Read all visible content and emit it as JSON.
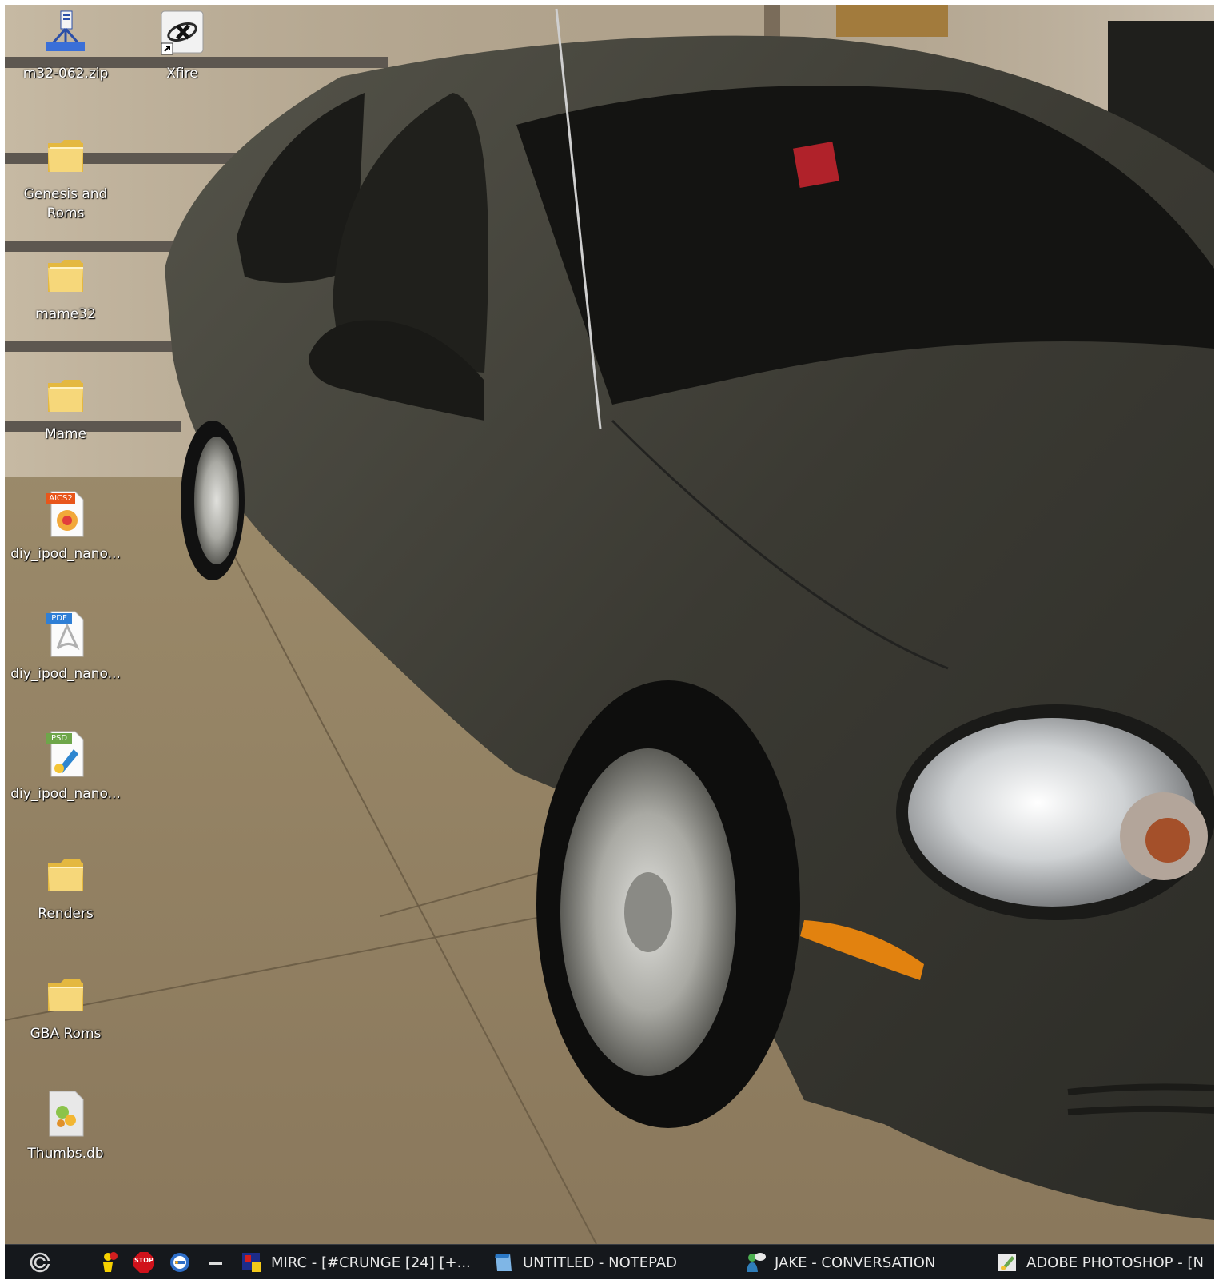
{
  "desktop": {
    "icons": [
      {
        "label": "m32-062.zip",
        "icon": "zip-network-icon"
      },
      {
        "label": "Xfire",
        "icon": "xfire-shortcut-icon"
      },
      {
        "label": "Genesis and\nRoms",
        "icon": "folder-icon"
      },
      {
        "label": "mame32",
        "icon": "folder-icon"
      },
      {
        "label": "Mame",
        "icon": "folder-icon"
      },
      {
        "label": "diy_ipod_nano...",
        "icon": "ai-file-icon",
        "badge": "AICS2"
      },
      {
        "label": "diy_ipod_nano...",
        "icon": "pdf-file-icon",
        "badge": "PDF"
      },
      {
        "label": "diy_ipod_nano...",
        "icon": "psd-file-icon",
        "badge": "PSD"
      },
      {
        "label": "Renders",
        "icon": "folder-icon"
      },
      {
        "label": "GBA Roms",
        "icon": "folder-icon"
      },
      {
        "label": "Thumbs.db",
        "icon": "db-file-icon"
      }
    ]
  },
  "taskbar": {
    "tray_icons": [
      "start-orb-icon",
      "aim-icon",
      "stop-icon",
      "messenger-icon",
      "minimize-icon"
    ],
    "stop_text": "STOP",
    "windows": [
      {
        "label": "MIRC - [#CRUNGE [24] [+...",
        "icon": "mirc-icon"
      },
      {
        "label": "UNTITLED - NOTEPAD",
        "icon": "notepad-icon"
      },
      {
        "label": "JAKE - CONVERSATION",
        "icon": "conversation-icon"
      },
      {
        "label": "ADOBE PHOTOSHOP - [N",
        "icon": "photoshop-icon"
      }
    ]
  },
  "colors": {
    "taskbar_bg": "#15181c",
    "folder_yellow": "#f3d36a",
    "car_body": "#3a3a34"
  }
}
